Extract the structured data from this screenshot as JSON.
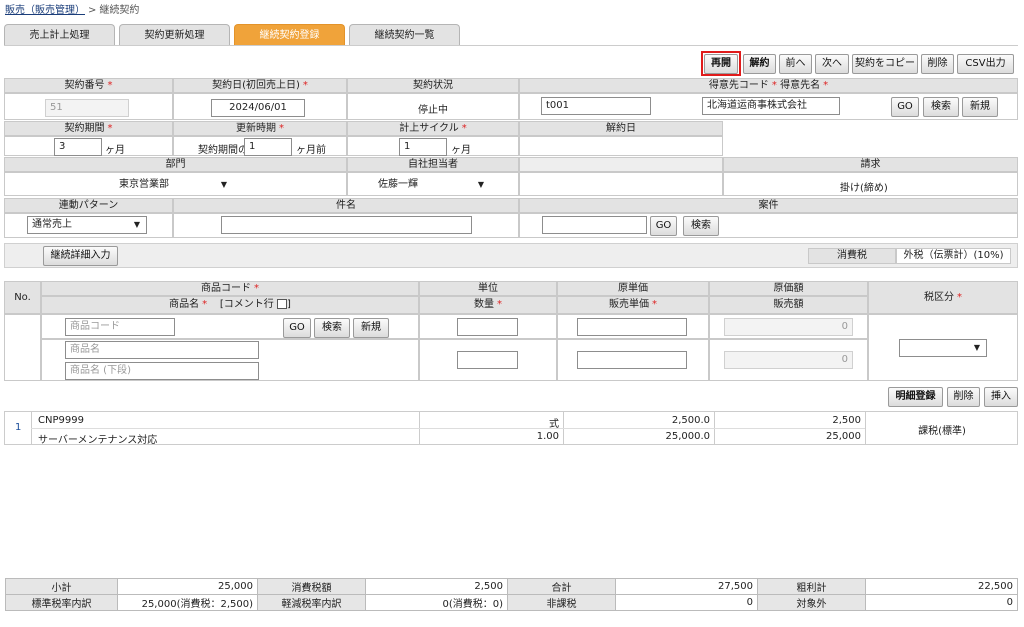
{
  "breadcrumb": {
    "parent": "販売（販売管理）",
    "sep": ">",
    "current": "継続契約"
  },
  "tabs": [
    "売上計上処理",
    "契約更新処理",
    "継続契約登録",
    "継続契約一覧"
  ],
  "toolbar": [
    "再開",
    "解約",
    "前へ",
    "次へ",
    "契約をコピー",
    "削除",
    "CSV出力"
  ],
  "required_mark": "*",
  "form": {
    "contract_no_label": "契約番号",
    "contract_no": "51",
    "contract_date_label": "契約日(初回売上日)",
    "contract_date": "2024/06/01",
    "status_label": "契約状況",
    "status": "停止中",
    "customer_label_code": "得意先コード",
    "customer_label_name": "得意先名",
    "customer_code": "t001",
    "customer_name": "北海道运商事株式会社",
    "go": "GO",
    "search": "検索",
    "new": "新規",
    "period_label": "契約期間",
    "period": "3",
    "period_unit": "ヶ月",
    "renew_label": "更新時期",
    "renew_prefix": "契約期間の",
    "renew_value": "1",
    "renew_unit": "ヶ月前",
    "cycle_label": "計上サイクル",
    "cycle": "1",
    "cycle_unit": "ヶ月",
    "cancel_date_label": "解約日",
    "dept_label": "部門",
    "dept": "東京営業部",
    "staff_label": "自社担当者",
    "staff": "佐藤一輝",
    "billing_label": "請求",
    "billing": "掛け(締め)",
    "pattern_label": "連動パターン",
    "pattern": "通常売上",
    "subject_label": "件名",
    "project_label": "案件"
  },
  "detail_btn": "継続詳細入力",
  "tax": {
    "label": "消費税",
    "value": "外税（伝票計）(10%)"
  },
  "lines_header": {
    "no": "No.",
    "product_code": "商品コード",
    "product_name": "商品名",
    "comment": "[コメント行",
    "comment_close": "]",
    "unit": "単位",
    "qty": "数量",
    "cost_price": "原単価",
    "sell_price": "販売単価",
    "cost_amount": "原価額",
    "sales_amount": "販売額",
    "tax_type": "税区分"
  },
  "entry": {
    "code_ph": "商品コード",
    "name_ph": "商品名",
    "name2_ph": "商品名 (下段)",
    "cost_amount": "0",
    "sales_amount": "0"
  },
  "line_actions": [
    "明細登録",
    "削除",
    "挿入"
  ],
  "lines": [
    {
      "no": "1",
      "code": "CNP9999",
      "name": "サーバーメンテナンス対応",
      "unit": "式",
      "qty": "1.00",
      "cost_price": "2,500.0",
      "sell_price": "25,000.0",
      "cost_amount": "2,500",
      "sales_amount": "25,000",
      "tax_type": "課税(標準)"
    }
  ],
  "footer": {
    "row1": [
      "小計",
      "25,000",
      "消費税額",
      "2,500",
      "合計",
      "27,500",
      "粗利計",
      "22,500"
    ],
    "row2": [
      "標準税率内訳",
      "25,000(消費税：2,500)",
      "軽減税率内訳",
      "0(消費税：0)",
      "非課税",
      "0",
      "対象外",
      "0"
    ]
  }
}
